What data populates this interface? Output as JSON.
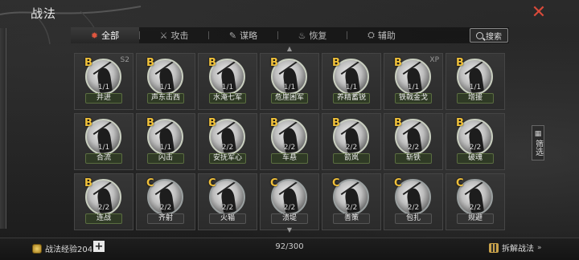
{
  "header": {
    "title": "战法",
    "close_glyph": "✕"
  },
  "tabs": [
    {
      "label": "全部",
      "icon": "all-icon",
      "glyph": "✹",
      "active": true
    },
    {
      "label": "攻击",
      "icon": "swords-icon",
      "glyph": "⚔",
      "active": false
    },
    {
      "label": "谋略",
      "icon": "scheme-icon",
      "glyph": "✎",
      "active": false
    },
    {
      "label": "恢复",
      "icon": "teapot-icon",
      "glyph": "♨",
      "active": false
    },
    {
      "label": "辅助",
      "icon": "support-icon",
      "glyph": "⛭",
      "active": false
    }
  ],
  "search": {
    "label": "搜索"
  },
  "skills": [
    {
      "grade": "B",
      "level": "1/1",
      "name": "并进",
      "tag": "S2"
    },
    {
      "grade": "B",
      "level": "1/1",
      "name": "声东击西",
      "tag": ""
    },
    {
      "grade": "B",
      "level": "1/1",
      "name": "水淹七军",
      "tag": ""
    },
    {
      "grade": "B",
      "level": "1/1",
      "name": "危崖困军",
      "tag": ""
    },
    {
      "grade": "B",
      "level": "1/1",
      "name": "养精蓄锐",
      "tag": ""
    },
    {
      "grade": "B",
      "level": "1/1",
      "name": "铁戟金戈",
      "tag": "XP"
    },
    {
      "grade": "B",
      "level": "1/1",
      "name": "增援",
      "tag": ""
    },
    {
      "grade": "B",
      "level": "1/1",
      "name": "合流",
      "tag": ""
    },
    {
      "grade": "B",
      "level": "1/1",
      "name": "闪击",
      "tag": ""
    },
    {
      "grade": "B",
      "level": "2/2",
      "name": "安抚军心",
      "tag": ""
    },
    {
      "grade": "B",
      "level": "2/2",
      "name": "车悬",
      "tag": ""
    },
    {
      "grade": "B",
      "level": "2/2",
      "name": "箭岚",
      "tag": ""
    },
    {
      "grade": "B",
      "level": "2/2",
      "name": "斩铁",
      "tag": ""
    },
    {
      "grade": "B",
      "level": "2/2",
      "name": "破魂",
      "tag": ""
    },
    {
      "grade": "B",
      "level": "2/2",
      "name": "连战",
      "tag": ""
    },
    {
      "grade": "C",
      "level": "2/2",
      "name": "齐射",
      "tag": ""
    },
    {
      "grade": "C",
      "level": "2/2",
      "name": "火辎",
      "tag": ""
    },
    {
      "grade": "C",
      "level": "2/2",
      "name": "溃堤",
      "tag": ""
    },
    {
      "grade": "C",
      "level": "2/2",
      "name": "善策",
      "tag": ""
    },
    {
      "grade": "C",
      "level": "2/2",
      "name": "包扎",
      "tag": ""
    },
    {
      "grade": "C",
      "level": "2/2",
      "name": "规避",
      "tag": ""
    }
  ],
  "filter": {
    "label": "筛选"
  },
  "footer": {
    "exp_label": "战法经验204",
    "plus": "+",
    "count": "92/300",
    "dismantle": "拆解战法",
    "dismantle_chevron": "»"
  }
}
